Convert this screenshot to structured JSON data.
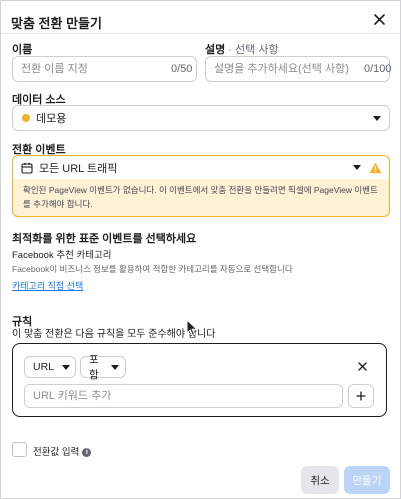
{
  "dialog": {
    "title": "맞춤 전환 만들기"
  },
  "name_field": {
    "label": "이름",
    "placeholder": "전환 이름 지정",
    "counter": "0/50"
  },
  "description_field": {
    "label": "설명",
    "label_suffix": " · 선택 사항",
    "placeholder": "설명을 추가하세요(선택 사항)",
    "counter": "0/100"
  },
  "data_source": {
    "label": "데이터 소스",
    "value": "데모용",
    "dot_color": "#f0b429"
  },
  "conversion_event": {
    "label": "전환 이벤트",
    "value": "모든 URL 트래픽",
    "warning": "확인된 PageView 이벤트가 없습니다. 이 이벤트에서 맞춤 전환을 만들려면 픽셀에 PageView 이벤트를 추가해야 합니다."
  },
  "optimization": {
    "heading": "최적화를 위한 표준 이벤트를 선택하세요",
    "subheading": "Facebook 추천 카테고리",
    "description": "Facebook이 비즈니스 정보를 활용하여 적합한 카테고리를 자동으로 선택합니다",
    "link": "카테고리 직접 선택"
  },
  "rules": {
    "label": "규칙",
    "description": "이 맞춤 전환은 다음 규칙을 모두 준수해야 합니다",
    "type_select": "URL",
    "operator_select": "포함",
    "keyword_placeholder": "URL 키워드 추가"
  },
  "conversion_value": {
    "label": "전환값 입력"
  },
  "footer": {
    "cancel_label": "취소",
    "create_label": "만들기"
  },
  "colors": {
    "warning_bg": "#fff1d6",
    "warning_border": "#f0b429",
    "link": "#1877f2",
    "primary_disabled": "#bcd4f6"
  }
}
